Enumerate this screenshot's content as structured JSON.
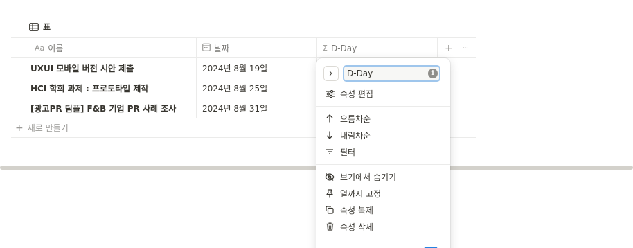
{
  "view": {
    "label": "표",
    "icon": "table-icon"
  },
  "table": {
    "columns": [
      {
        "label": "이름",
        "icon_text": "Aa"
      },
      {
        "label": "날짜",
        "icon": "calendar-icon"
      },
      {
        "label": "D-Day",
        "icon_text": "Σ"
      }
    ],
    "header_actions": {
      "add": "+",
      "more": "···"
    },
    "rows": [
      {
        "name": "UXUI 모바일 버전 시안 제출",
        "date": "2024년 8월 19일"
      },
      {
        "name": "HCI 학회 과제 : 프로토타입 제작",
        "date": "2024년 8월 25일"
      },
      {
        "name": "[광고PR 팀플] F&B 기업 PR 사례 조사",
        "date": "2024년 8월 31일"
      }
    ],
    "new_row_label": "새로 만들기"
  },
  "menu": {
    "type_symbol": "Σ",
    "name_value": "D-Day",
    "info_symbol": "i",
    "items": [
      {
        "label": "속성 편집",
        "icon": "sliders-icon"
      },
      {
        "label": "오름차순",
        "icon": "arrow-up-icon"
      },
      {
        "label": "내림차순",
        "icon": "arrow-down-icon"
      },
      {
        "label": "필터",
        "icon": "filter-icon"
      },
      {
        "label": "보기에서 숨기기",
        "icon": "eye-off-icon"
      },
      {
        "label": "열까지 고정",
        "icon": "pin-icon"
      },
      {
        "label": "속성 복제",
        "icon": "duplicate-icon"
      },
      {
        "label": "속성 삭제",
        "icon": "trash-icon"
      }
    ]
  },
  "colors": {
    "text": "#37352f",
    "muted": "#787774",
    "border": "#ebebea",
    "focus": "#9fc6ec",
    "accent": "#2383e2",
    "scrollbar": "#d3d1cb"
  }
}
